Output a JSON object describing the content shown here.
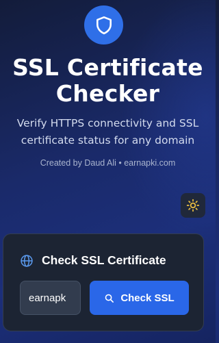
{
  "header": {
    "logo_icon": "shield-icon",
    "title": "SSL Certificate Checker",
    "subtitle": "Verify HTTPS connectivity and SSL certificate status for any domain",
    "credit": "Created by Daud Ali • earnapki.com"
  },
  "theme_toggle": {
    "icon": "sun-icon",
    "icon_color": "#f5c542"
  },
  "card": {
    "icon": "globe-icon",
    "title": "Check SSL Certificate",
    "domain_input_value": "earnapk",
    "check_button_icon": "search-icon",
    "check_button_label": "Check SSL"
  },
  "colors": {
    "accent": "#2a67e8",
    "logo_bg": "#2f6fe8",
    "card_bg": "#1c2433",
    "globe_icon": "#5b9bf0"
  }
}
